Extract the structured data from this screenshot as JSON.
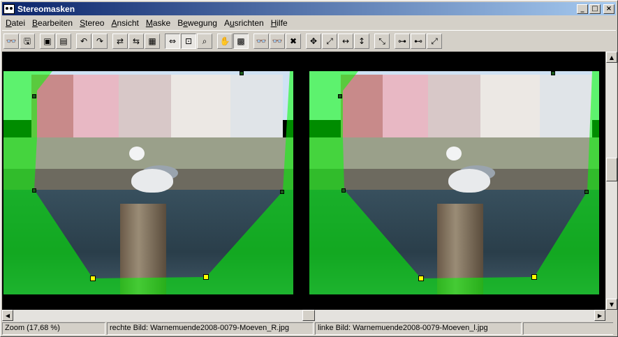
{
  "window": {
    "title": "Stereomasken"
  },
  "menu": [
    {
      "label": "Datei",
      "accel": "D"
    },
    {
      "label": "Bearbeiten",
      "accel": "B"
    },
    {
      "label": "Stereo",
      "accel": "S"
    },
    {
      "label": "Ansicht",
      "accel": "A"
    },
    {
      "label": "Maske",
      "accel": "M"
    },
    {
      "label": "Bewegung",
      "accel": "e"
    },
    {
      "label": "Ausrichten",
      "accel": "u"
    },
    {
      "label": "Hilfe",
      "accel": "H"
    }
  ],
  "toolbar": {
    "groups": [
      [
        {
          "icon": "stereo-open-icon",
          "glyph": "👓"
        },
        {
          "icon": "save-icon",
          "glyph": "🖫"
        }
      ],
      [
        {
          "icon": "stereo-pair-icon",
          "glyph": "▣"
        },
        {
          "icon": "split-view-icon",
          "glyph": "▤"
        }
      ],
      [
        {
          "icon": "undo-icon",
          "glyph": "↶"
        },
        {
          "icon": "redo-icon",
          "glyph": "↷"
        }
      ],
      [
        {
          "icon": "swap-x-icon",
          "glyph": "⇄"
        },
        {
          "icon": "swap-images-icon",
          "glyph": "⇆"
        },
        {
          "icon": "color-image-icon",
          "glyph": "▦"
        }
      ],
      [
        {
          "icon": "fit-width-icon",
          "glyph": "⇔",
          "pressed": true
        },
        {
          "icon": "fit-window-icon",
          "glyph": "⊡",
          "pressed": true
        },
        {
          "icon": "zoom-icon",
          "glyph": "⌕"
        }
      ],
      [
        {
          "icon": "hand-pan-icon",
          "glyph": "✋"
        },
        {
          "icon": "mask-green-icon",
          "glyph": "▩",
          "pressed": true
        }
      ],
      [
        {
          "icon": "anaglyph-icon",
          "glyph": "👓"
        },
        {
          "icon": "anaglyph-bw-icon",
          "glyph": "👓"
        },
        {
          "icon": "delete-mask-icon",
          "glyph": "✖"
        }
      ],
      [
        {
          "icon": "move-all-icon",
          "glyph": "✥"
        },
        {
          "icon": "move-diagonal-icon",
          "glyph": "⤢"
        },
        {
          "icon": "move-horizontal-icon",
          "glyph": "↔"
        },
        {
          "icon": "move-vertical-icon",
          "glyph": "↕"
        }
      ],
      [
        {
          "icon": "align-diagonal-icon",
          "glyph": "⤡"
        }
      ],
      [
        {
          "icon": "align-points-icon",
          "glyph": "⊶"
        },
        {
          "icon": "align-points-2-icon",
          "glyph": "⊷"
        },
        {
          "icon": "align-rotate-icon",
          "glyph": "⤢"
        }
      ]
    ]
  },
  "viewer": {
    "left_image_role": "rechte Bild",
    "right_image_role": "linke Bild",
    "mask_color": "#00ff00",
    "handle_color": "#ffff00"
  },
  "statusbar": {
    "zoom": "Zoom (17,68 %)",
    "right_image": "rechte Bild: Warnemuende2008-0079-Moeven_R.jpg",
    "left_image": "linke Bild: Warnemuende2008-0079-Moeven_l.jpg"
  },
  "colors": {
    "title_active": "#0a246a",
    "title_gradient_end": "#a6caf0",
    "face": "#d4d0c8"
  }
}
